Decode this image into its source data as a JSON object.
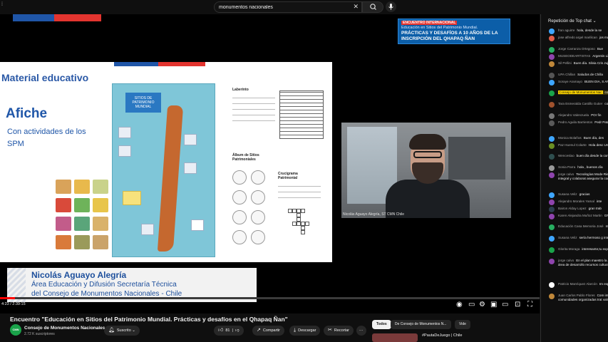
{
  "search": {
    "query": "monumentos nacionales"
  },
  "banner": {
    "tag": "ENCUENTRO INTERNACIONAL",
    "line1": "Educación en Sitios del Patrimonio Mundial.",
    "line2": "PRÁCTICAS Y DESAFÍOS A 10 AÑOS DE LA INSCRIPCIÓN DEL QHAPAQ ÑAN"
  },
  "slide": {
    "title": "Material educativo",
    "heading": "Afiche",
    "subtitle": "Con actividades de los SPM",
    "poster_title": "SITIOS DE PATRIMONIO MUNDIAL",
    "worksheet_labels": [
      "Laberinto",
      "Álbum de Sitios Patrimoniales",
      "Crucigrama Patrimonial"
    ]
  },
  "lower_third": {
    "name": "Nicolás Aguayo Alegría",
    "role1": "Área Educación y Difusión Secretaría Técnica",
    "role2": "del Consejo de Monumentos Nacionales - Chile"
  },
  "webcam": {
    "caption": "Nicolás Aguayo Alegría, ST CMN Chile"
  },
  "player": {
    "time": "4:23 / 2:39:15",
    "progress_fraction": 0.028
  },
  "video": {
    "title": "Encuentro \"Educación en Sitios del Patrimonio Mundial. Prácticas y desafíos en el Qhapaq Ñan\"",
    "channel_name": "Consejo de Monumentos Nacionales",
    "channel_avatar": "CMN",
    "subscribers": "2.72 K suscriptores",
    "subscribed_label": "Suscrito",
    "likes": "81",
    "share_label": "Compartir",
    "download_label": "Descargar",
    "clip_label": "Recortar"
  },
  "chips": [
    "Todos",
    "De Consejo de Monumentos N...",
    "Vide"
  ],
  "recommendation": {
    "title": "#PautaDeJuego | Chile"
  },
  "chat": {
    "header": "Repetición de Top chat",
    "messages": [
      {
        "author": "fran aguirre",
        "text": "hola, desde la se",
        "color": "#3ea6ff"
      },
      {
        "author": "jose alfredo argel marilican",
        "text": "jos marilican,Puerto Montt",
        "color": "#e25d48"
      },
      {
        "author": "Jorge Carranza Ortegoso",
        "text": "Bue",
        "color": "#27ae60"
      },
      {
        "author": "MUSEODEARTISTAS",
        "text": "Argentin Limache",
        "color": "#8e44ad"
      },
      {
        "author": "Sil Pellini",
        "text": "Buen día. Silvia Cris Jujuy, Argentina.",
        "color": "#c0883a"
      },
      {
        "author": "UPA Chillan",
        "text": "Saludos de Chilla",
        "color": "#555555"
      },
      {
        "author": "Soraye Aramayo",
        "text": "BUEN DIA, S ANTOFAGASTA, COMUNA DE",
        "color": "#3ea6ff"
      },
      {
        "author": "Consejo de Monumentos Nac",
        "text": "conectarse, iniciamos en unos",
        "color": "#1aa34a",
        "highlight": true
      },
      {
        "author": "Tara Esmeralda Castillo Gutier",
        "text": "comuna de Chanco , región de",
        "color": "#a0522d"
      },
      {
        "author": "Alejandro Valenzuela",
        "text": "POr fin",
        "color": "#777777"
      },
      {
        "author": "Pedro Aguila Barrientos",
        "text": "Pedr Patagonia chilena, Puerto Nata Municipal",
        "color": "#5a5a5a"
      },
      {
        "author": "Monica Bolaños",
        "text": "Buen día, des",
        "color": "#3ea6ff"
      },
      {
        "author": "Paz Huenul Colarte",
        "text": "Hola desc Universitario del Grabado - Upl",
        "color": "#6b8e23"
      },
      {
        "author": "Wenceslao",
        "text": "buen día desde la comuna de Arauco!",
        "color": "#2f4f4f"
      },
      {
        "author": "Sonia Parra",
        "text": "hola , buenos día",
        "color": "#999999"
      },
      {
        "author": "jorge calvo",
        "text": "Tecnologías Mode Riesgos, intercambio de Conoc estrategia integral y colaborat asegurar la conservación y ma del Qhapaq Ñan.",
        "color": "#8e44ad"
      },
      {
        "author": "Susana Veliz",
        "text": "gracias",
        "color": "#3ea6ff"
      },
      {
        "author": "Alejandro Morales Yamal",
        "text": "inte",
        "color": "#8e44ad"
      },
      {
        "author": "Bairon Alday Lopez",
        "text": "gran trab",
        "color": "#2c3e50"
      },
      {
        "author": "Karen Alejandra Muñoz Martin",
        "text": "GRACIAS",
        "color": "#8e44ad"
      },
      {
        "author": "Educación Casa Memoria José",
        "text": "muchas gracias",
        "color": "#27ae60"
      },
      {
        "author": "Susana Veliz",
        "text": "sería hermoso g intercambio cultural",
        "color": "#3ea6ff"
      },
      {
        "author": "Glorita Moraga",
        "text": "interesante,tu expositores!!",
        "color": "#1aa34a"
      },
      {
        "author": "jorge calvo",
        "text": "En el plan maestro la administración (gobernanza dentro del área de desarrollo recursos culturales y ancestra indígena convenio 169.",
        "color": "#8e44ad"
      },
      {
        "author": "Patricio Manríquez Alarcón",
        "text": "Im exposiciones, muchas gracias",
        "color": "#ffffff"
      },
      {
        "author": "Juan Carlos Pablo Flores",
        "text": "Com importancia de tomar encuenti comunidades organizadas trat valor del Qhapaq Ñan, Sistema",
        "color": "#c0883a"
      }
    ]
  },
  "colors": {
    "accent_red": "#ff0000",
    "chile_blue": "#1f56a8",
    "banner_blue": "#0c5ea8",
    "cmn_green": "#1aa34a"
  }
}
